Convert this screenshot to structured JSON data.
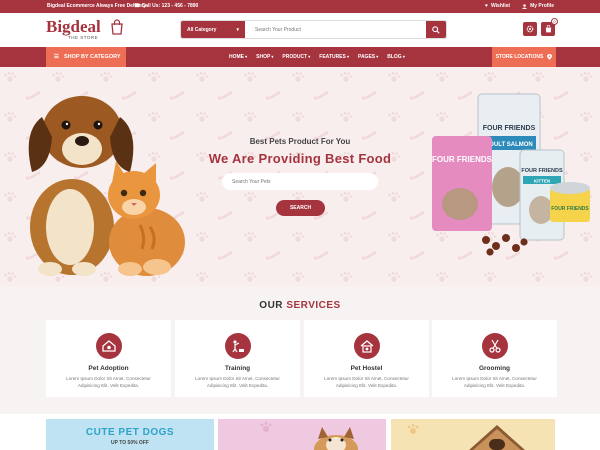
{
  "topbar": {
    "promo": "Bigdeal Ecommerce Always Free Delivery",
    "phone": "Call Us: 123 - 456 - 7890",
    "wishlist": "Wishlist",
    "profile": "My Profile"
  },
  "header": {
    "logo_name": "Bigdeal",
    "logo_sub": "THE STORE",
    "category_label": "All Category",
    "search_placeholder": "Search Your Product",
    "cart_count": "0"
  },
  "nav": {
    "shop_by_category": "SHOP BY CATEGORY",
    "menu": [
      "HOME",
      "SHOP",
      "PRODUCT",
      "FEATURES",
      "PAGES",
      "BLOG"
    ],
    "store_locations": "STORE LOCATIONS"
  },
  "hero": {
    "subtitle": "Best Pets Product For You",
    "title": "We Are Providing Best Food",
    "search_placeholder": "Search Your Pets",
    "button": "SEARCH",
    "bag1_text": "FOUR FRIENDS",
    "bag2_text": "FOUR FRIENDS",
    "bag2_sub": "ADULT SALMON",
    "bag3_text": "FOUR FRIENDS",
    "bag3_sub": "KITTEN",
    "can_text": "FOUR FRIENDS"
  },
  "services": {
    "title_a": "OUR",
    "title_b": "SERVICES",
    "items": [
      {
        "title": "Pet Adoption",
        "desc": "Lorem Ipsum Dolor Sit Amet, Consectetur Adipisicing Elit. Velit Expedita."
      },
      {
        "title": "Training",
        "desc": "Lorem Ipsum Dolor Sit Amet, Consectetur Adipisicing Elit. Velit Expedita."
      },
      {
        "title": "Pet Hostel",
        "desc": "Lorem Ipsum Dolor Sit Amet, Consectetur Adipisicing Elit. Velit Expedita."
      },
      {
        "title": "Grooming",
        "desc": "Lorem Ipsum Dolor Sit Amet, Consectetur Adipisicing Elit. Velit Expedita."
      }
    ]
  },
  "banners": {
    "b1_title": "CUTE PET DOGS",
    "b1_sub": "UP TO 50% OFF"
  },
  "colors": {
    "primary": "#a5343f",
    "accent": "#ee6e55",
    "hero_bg": "#f9eeee"
  }
}
